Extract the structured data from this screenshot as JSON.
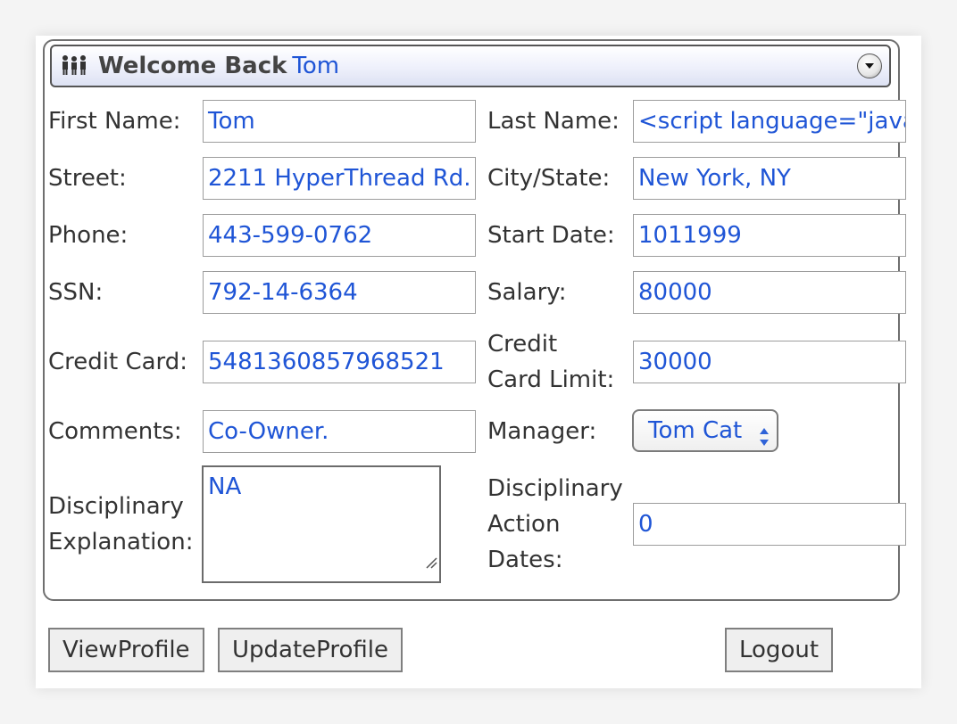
{
  "header": {
    "welcome_text": "Welcome Back",
    "username": "Tom"
  },
  "form": {
    "first_name": {
      "label": "First Name:",
      "value": "Tom"
    },
    "last_name": {
      "label": "Last Name:",
      "value": "<script language=\"java"
    },
    "street": {
      "label": "Street:",
      "value": "2211 HyperThread Rd."
    },
    "city_state": {
      "label": "City/State:",
      "value": "New York, NY"
    },
    "phone": {
      "label": "Phone:",
      "value": "443-599-0762"
    },
    "start_date": {
      "label": "Start Date:",
      "value": "1011999"
    },
    "ssn": {
      "label": "SSN:",
      "value": "792-14-6364"
    },
    "salary": {
      "label": "Salary:",
      "value": "80000"
    },
    "credit_card": {
      "label": "Credit Card:",
      "value": "5481360857968521"
    },
    "credit_card_limit": {
      "label_line1": "Credit",
      "label_line2": "Card Limit:",
      "value": "30000"
    },
    "comments": {
      "label": "Comments:",
      "value": "Co-Owner."
    },
    "manager": {
      "label": "Manager:",
      "value": "Tom Cat"
    },
    "disciplinary_explanation": {
      "label_line1": "Disciplinary",
      "label_line2": "Explanation:",
      "value": "NA"
    },
    "disciplinary_action_dates": {
      "label_line1": "Disciplinary",
      "label_line2": "Action",
      "label_line3": "Dates:",
      "value": "0"
    }
  },
  "buttons": {
    "view_profile": "ViewProfile",
    "update_profile": "UpdateProfile",
    "logout": "Logout"
  },
  "icons": {
    "header": "people-icon",
    "collapse": "chevron-down-icon"
  },
  "colors": {
    "value_text": "#1f55d6",
    "label_text": "#333333"
  }
}
